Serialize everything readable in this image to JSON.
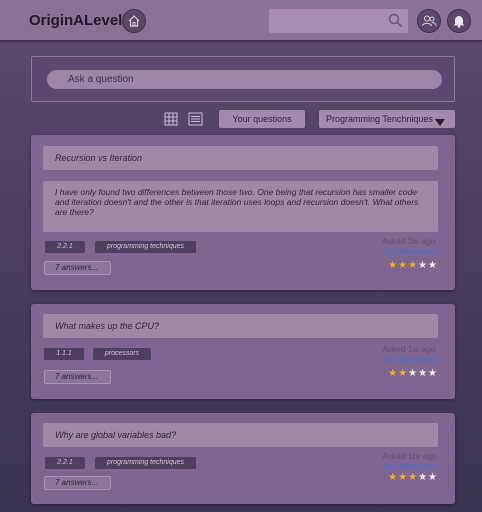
{
  "header": {
    "logo": "OriginALevel",
    "search_placeholder": ""
  },
  "ask": {
    "placeholder": "Ask a question"
  },
  "toolbar": {
    "your_questions": "Your questions",
    "topic": "Programming Tenchniques"
  },
  "questions": [
    {
      "title": "Recursion vs Iteration",
      "body": "I have only found two differences between those two. One being that recursion has smaller code and iteration doesn't and the other is that iteration uses loops and recursion doesn't. What others are there?",
      "spec": "2.2.1",
      "topic": "programming techniques",
      "answers": "7 answers...",
      "asked_label": "Asked",
      "asked_ago": "2w ago",
      "author": "Ana Morosanu",
      "rating": 3
    },
    {
      "title": "What makes up the CPU?",
      "body": "",
      "spec": "1.1.1",
      "topic": "processors",
      "answers": "7 answers...",
      "asked_label": "Asked",
      "asked_ago": "1w ago",
      "author": "Ana Morosanu",
      "rating": 2
    },
    {
      "title": "Why are global variables bad?",
      "body": "",
      "spec": "2.2.1",
      "topic": "programming techniques",
      "answers": "7 answers...",
      "asked_label": "Asked",
      "asked_ago": "1hr ago",
      "author": "Ana Morosanu",
      "rating": 3
    }
  ],
  "rating_max": 5,
  "colors": {
    "header": "#8a7196",
    "card": "#7f6690",
    "star": "#f0b020",
    "author": "#3b6fd4"
  }
}
